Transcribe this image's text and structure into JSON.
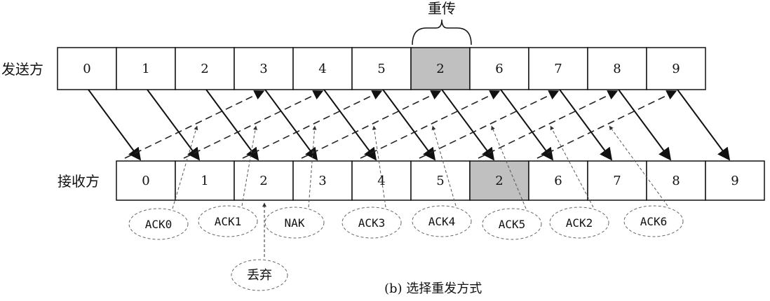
{
  "sender": {
    "label": "发送方",
    "frames": [
      "0",
      "1",
      "2",
      "3",
      "4",
      "5",
      "2",
      "6",
      "7",
      "8",
      "9"
    ],
    "highlight_index": 6
  },
  "receiver": {
    "label": "接收方",
    "frames": [
      "0",
      "1",
      "2",
      "3",
      "4",
      "5",
      "2",
      "6",
      "7",
      "8",
      "9"
    ],
    "highlight_index": 6
  },
  "retransmit_label": "重传",
  "discard_label": "丢弃",
  "acks": [
    "ACK0",
    "ACK1",
    "NAK",
    "ACK3",
    "ACK4",
    "ACK5",
    "ACK2",
    "ACK6"
  ],
  "caption": "(b) 选择重发方式",
  "colors": {
    "highlight": "#c0c0c0",
    "stroke": "#111111",
    "dashed": "#555555"
  }
}
